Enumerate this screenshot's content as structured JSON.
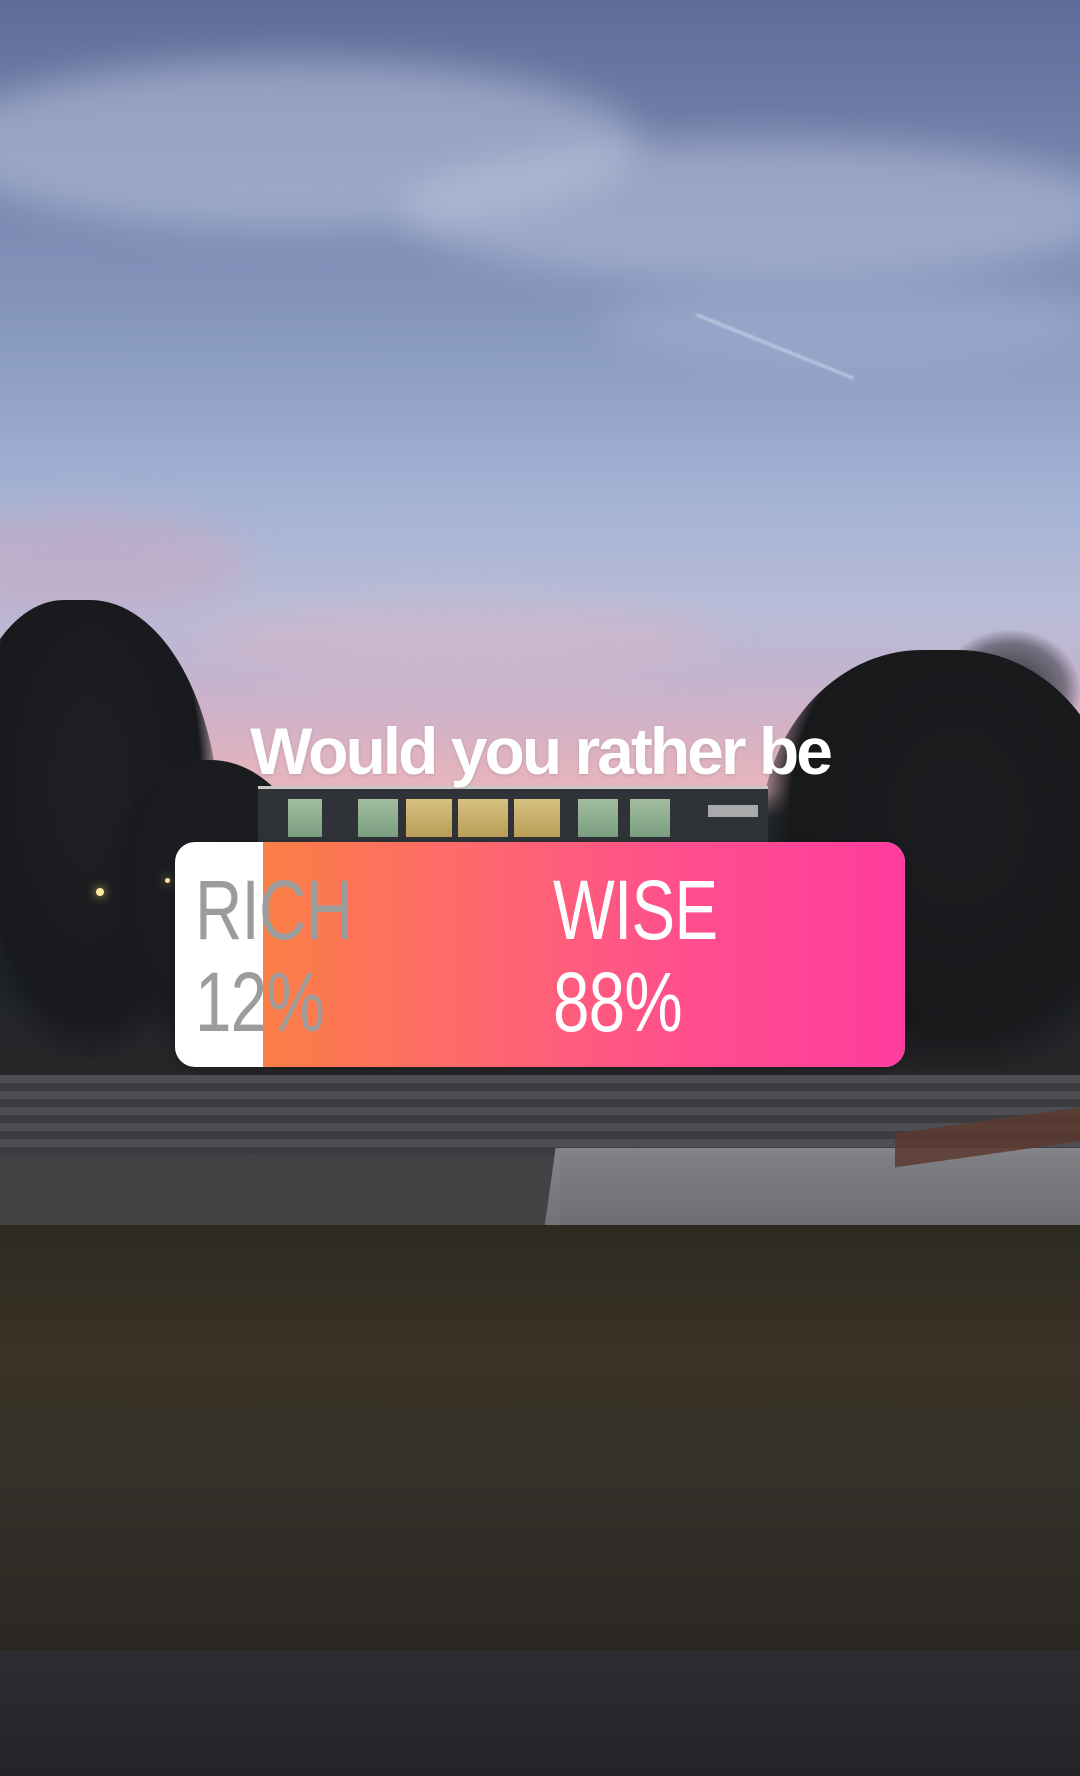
{
  "story": {
    "question": "Would you rather be",
    "poll": {
      "options": [
        {
          "label": "RICH",
          "percent_label": "12%",
          "percent": 12
        },
        {
          "label": "WISE",
          "percent_label": "88%",
          "percent": 88
        }
      ],
      "colors": {
        "gradient_start": "#fb7e44",
        "gradient_end": "#ff3d9e",
        "empty": "#ffffff",
        "losing_text": "#9c9c9c",
        "winning_text": "#ffffff"
      }
    }
  }
}
